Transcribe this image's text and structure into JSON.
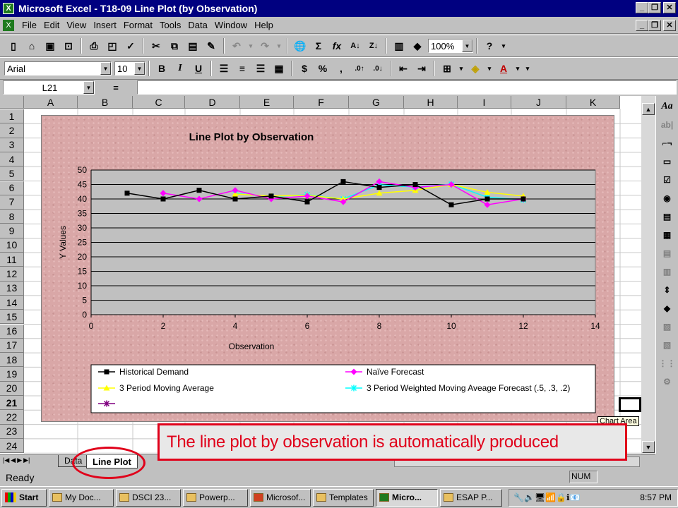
{
  "window": {
    "title": "Microsoft Excel - T18-09 Line Plot (by Observation)"
  },
  "menu": [
    "File",
    "Edit",
    "View",
    "Insert",
    "Format",
    "Tools",
    "Data",
    "Window",
    "Help"
  ],
  "toolbar": {
    "zoom": "100%",
    "font": "Arial",
    "size": "10",
    "bold": "B",
    "italic": "I",
    "underline": "U",
    "currency": "$",
    "percent": "%",
    "comma": ",",
    "sigma": "Σ",
    "fx": "fx",
    "help": "?"
  },
  "formula": {
    "name_box": "L21",
    "equals": "="
  },
  "columns": [
    "A",
    "B",
    "C",
    "D",
    "E",
    "F",
    "G",
    "H",
    "I",
    "J",
    "K"
  ],
  "rows": [
    "1",
    "2",
    "3",
    "4",
    "5",
    "6",
    "7",
    "8",
    "9",
    "10",
    "11",
    "12",
    "13",
    "14",
    "15",
    "16",
    "17",
    "18",
    "19",
    "20",
    "21",
    "22",
    "23",
    "24"
  ],
  "chart_data": {
    "type": "line",
    "title": "Line Plot by Observation",
    "xlabel": "Observation",
    "ylabel": "Y Values",
    "xlim": [
      0,
      14
    ],
    "ylim": [
      0,
      50
    ],
    "xticks": [
      "0",
      "2",
      "4",
      "6",
      "8",
      "10",
      "12",
      "14"
    ],
    "yticks": [
      "0",
      "5",
      "10",
      "15",
      "20",
      "25",
      "30",
      "35",
      "40",
      "45",
      "50"
    ],
    "grid": true,
    "legend_position": "bottom",
    "series": [
      {
        "name": "Historical Demand",
        "color": "#000000",
        "marker": "square",
        "x": [
          1,
          2,
          3,
          4,
          5,
          6,
          7,
          8,
          9,
          10,
          11,
          12
        ],
        "y": [
          42,
          40,
          43,
          40,
          41,
          39,
          46,
          44,
          45,
          38,
          40,
          40
        ]
      },
      {
        "name": "Naïve Forecast",
        "color": "#ff00ff",
        "marker": "diamond",
        "x": [
          2,
          3,
          4,
          5,
          6,
          7,
          8,
          9,
          10,
          11,
          12
        ],
        "y": [
          42,
          40,
          43,
          40,
          41,
          39,
          46,
          44,
          45,
          38,
          40
        ]
      },
      {
        "name": "3 Period Moving Average",
        "color": "#ffff00",
        "marker": "triangle",
        "x": [
          4,
          5,
          6,
          7,
          8,
          9,
          10,
          11,
          12
        ],
        "y": [
          41.7,
          41,
          41.3,
          40,
          42,
          43,
          45,
          42.3,
          41
        ]
      },
      {
        "name": "3 Period Weighted Moving Aveage Forecast (.5, .3, .2)",
        "color": "#00ffff",
        "marker": "star",
        "x": [
          4,
          5,
          6,
          7,
          8,
          9,
          10,
          11,
          12
        ],
        "y": [
          41.9,
          40.8,
          41.5,
          40,
          44.9,
          44.1,
          45.1,
          40.6,
          39.7
        ]
      },
      {
        "name": "",
        "color": "#800080",
        "marker": "star",
        "x": [],
        "y": []
      }
    ]
  },
  "tooltip": "Chart Area",
  "sheets": [
    "Data",
    "Line Plot"
  ],
  "status": {
    "left": "Ready",
    "num": "NUM"
  },
  "callout": "The line plot by observation is automatically produced",
  "taskbar": {
    "start": "Start",
    "items": [
      "My Doc...",
      "DSCI 23...",
      "Powerp...",
      "Microsof...",
      "Templates",
      "Micro...",
      "ESAP P..."
    ],
    "clock": "8:57 PM"
  },
  "colors": {
    "title_bar": "#000080",
    "chart_bg": "#d9a7a7",
    "callout": "#e0001a"
  }
}
